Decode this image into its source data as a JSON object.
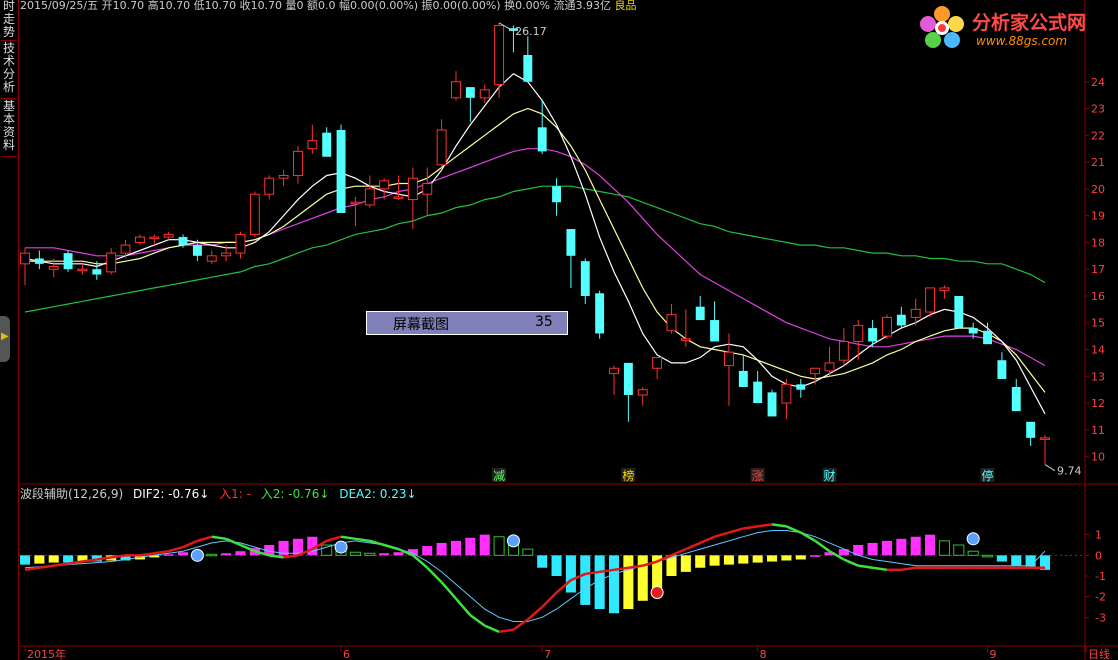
{
  "sidebar": {
    "tabs": [
      "时走势",
      "技术分析",
      "基本资料"
    ]
  },
  "infobar": {
    "text": "2015/09/25/五 开10.70 高10.70 低10.70 收10.70 量0 额0.0 幅0.00(0.00%) 振0.00(0.00%) 换0.00% 流通3.93亿",
    "tag": "良品"
  },
  "logo": {
    "title": "分析家公式网",
    "url": "www.88gs.com"
  },
  "screenshot_box": {
    "label": "屏幕截图",
    "value": "35"
  },
  "indicator": {
    "name": "波段辅助(12,26,9)",
    "dif2": "DIF2: -0.76",
    "in1": "入1: -",
    "in2": "入2: -0.76",
    "dea2": "DEA2: 0.23",
    "arrow": "↓"
  },
  "colors": {
    "up": "#ff3030",
    "down": "#54ffff",
    "ma_short": "#ffffff",
    "ma_mid": "#ffffa0",
    "ma_long": "#e040e0",
    "ma_longer": "#20c040",
    "grid": "#8b0000"
  },
  "chart_data": {
    "type": "candlestick",
    "price_axis": {
      "ylim": [
        9.5,
        25
      ],
      "ticks": [
        10,
        11,
        12,
        13,
        14,
        15,
        16,
        17,
        18,
        19,
        20,
        21,
        22,
        23,
        24
      ]
    },
    "annotations": {
      "high": "26.17",
      "low": "9.74"
    },
    "event_labels": [
      {
        "label": "减",
        "index": 18
      },
      {
        "label": "榜",
        "index": 23
      },
      {
        "label": "涨",
        "index": 28
      },
      {
        "label": "财",
        "index": 31
      },
      {
        "label": "停",
        "index": 37
      }
    ],
    "x_labels": [
      {
        "label": "2015年",
        "index": 0
      },
      {
        "label": "6",
        "index": 12
      },
      {
        "label": "7",
        "index": 20
      },
      {
        "label": "8",
        "index": 28
      },
      {
        "label": "9",
        "index": 37
      },
      {
        "label": "日线",
        "index": 39
      }
    ],
    "candles": [
      [
        17.2,
        17.8,
        16.4,
        17.6
      ],
      [
        17.4,
        17.7,
        17.0,
        17.2
      ],
      [
        17.0,
        17.4,
        16.7,
        17.1
      ],
      [
        17.6,
        17.7,
        16.9,
        17.0
      ],
      [
        17.0,
        17.2,
        16.8,
        17.0
      ],
      [
        17.0,
        17.3,
        16.6,
        16.8
      ],
      [
        16.9,
        17.8,
        16.8,
        17.6
      ],
      [
        17.6,
        18.1,
        17.4,
        17.9
      ],
      [
        18.0,
        18.3,
        17.9,
        18.2
      ],
      [
        18.2,
        18.3,
        17.9,
        18.2
      ],
      [
        18.2,
        18.4,
        18.1,
        18.3
      ],
      [
        18.2,
        18.3,
        17.8,
        17.9
      ],
      [
        17.9,
        18.1,
        17.3,
        17.5
      ],
      [
        17.3,
        17.7,
        17.2,
        17.5
      ],
      [
        17.5,
        17.9,
        17.3,
        17.6
      ],
      [
        17.6,
        18.4,
        17.4,
        18.3
      ],
      [
        18.3,
        19.9,
        18.2,
        19.8
      ],
      [
        19.8,
        20.5,
        19.6,
        20.4
      ],
      [
        20.4,
        20.7,
        20.1,
        20.5
      ],
      [
        20.5,
        21.6,
        20.2,
        21.4
      ],
      [
        21.5,
        22.4,
        21.3,
        21.8
      ],
      [
        22.1,
        22.3,
        21.3,
        21.2
      ],
      [
        22.2,
        22.4,
        19.5,
        19.1
      ],
      [
        19.5,
        19.7,
        18.6,
        19.5
      ],
      [
        19.4,
        20.5,
        19.3,
        20.0
      ],
      [
        20.0,
        20.4,
        19.6,
        20.3
      ],
      [
        19.7,
        20.5,
        19.6,
        19.7
      ],
      [
        19.6,
        20.8,
        18.5,
        20.4
      ],
      [
        19.8,
        20.8,
        19.0,
        20.2
      ],
      [
        20.9,
        22.6,
        20.8,
        22.2
      ],
      [
        23.4,
        24.4,
        23.3,
        24.0
      ],
      [
        23.8,
        23.8,
        22.5,
        23.4
      ],
      [
        23.4,
        23.9,
        23.2,
        23.7
      ],
      [
        23.9,
        26.2,
        23.4,
        26.1
      ],
      [
        26.0,
        26.1,
        25.1,
        25.9
      ],
      [
        25.0,
        25.7,
        24.0,
        24.0
      ],
      [
        22.3,
        23.3,
        21.3,
        21.4
      ],
      [
        20.1,
        20.4,
        19.0,
        19.5
      ],
      [
        18.5,
        18.5,
        16.3,
        17.5
      ],
      [
        17.3,
        17.4,
        15.7,
        16.0
      ],
      [
        16.1,
        16.2,
        14.4,
        14.6
      ],
      [
        13.1,
        13.4,
        12.3,
        13.3
      ],
      [
        13.5,
        13.5,
        11.3,
        12.3
      ],
      [
        12.3,
        12.6,
        11.9,
        12.5
      ],
      [
        13.3,
        13.6,
        12.9,
        13.7
      ],
      [
        14.7,
        15.7,
        14.6,
        15.3
      ],
      [
        14.4,
        15.5,
        14.1,
        14.4
      ],
      [
        15.6,
        16.0,
        15.1,
        15.1
      ],
      [
        15.1,
        15.8,
        14.6,
        14.3
      ],
      [
        13.4,
        14.6,
        11.9,
        13.9
      ],
      [
        13.2,
        13.8,
        12.8,
        12.6
      ],
      [
        12.8,
        13.2,
        12.1,
        12.0
      ],
      [
        12.4,
        12.5,
        11.9,
        11.5
      ],
      [
        12.0,
        12.9,
        11.4,
        12.7
      ],
      [
        12.7,
        12.9,
        12.2,
        12.5
      ],
      [
        13.1,
        13.3,
        12.7,
        13.3
      ],
      [
        13.2,
        14.1,
        13.0,
        13.5
      ],
      [
        13.6,
        14.8,
        13.4,
        14.3
      ],
      [
        14.3,
        15.1,
        13.6,
        14.9
      ],
      [
        14.8,
        15.1,
        14.1,
        14.3
      ],
      [
        14.5,
        15.3,
        14.4,
        15.2
      ],
      [
        15.3,
        15.6,
        14.8,
        14.9
      ],
      [
        15.2,
        15.9,
        14.9,
        15.5
      ],
      [
        15.4,
        16.3,
        15.2,
        16.3
      ],
      [
        16.2,
        16.4,
        15.9,
        16.3
      ],
      [
        16.0,
        16.0,
        14.8,
        14.8
      ],
      [
        14.8,
        15.0,
        14.4,
        14.6
      ],
      [
        14.7,
        15.0,
        14.2,
        14.2
      ],
      [
        13.6,
        13.9,
        12.9,
        12.9
      ],
      [
        12.6,
        12.9,
        11.8,
        11.7
      ],
      [
        11.3,
        11.3,
        10.4,
        10.7
      ],
      [
        10.7,
        10.8,
        9.7,
        10.7
      ]
    ],
    "ma": {
      "white": [
        17.3,
        17.3,
        17.2,
        17.2,
        17.2,
        17.1,
        17.3,
        17.5,
        17.7,
        17.9,
        18.1,
        18.1,
        18.0,
        17.9,
        17.8,
        17.8,
        18.0,
        18.4,
        19.0,
        19.6,
        20.1,
        20.5,
        20.6,
        20.4,
        20.1,
        19.9,
        19.8,
        19.7,
        20.0,
        20.7,
        21.6,
        22.4,
        23.1,
        23.8,
        24.3,
        24.0,
        23.3,
        22.4,
        21.2,
        19.8,
        18.2,
        16.9,
        15.8,
        14.6,
        13.8,
        13.5,
        13.5,
        13.7,
        14.1,
        14.2,
        14.1,
        13.6,
        13.0,
        12.7,
        12.6,
        12.8,
        13.1,
        13.4,
        13.8,
        14.2,
        14.5,
        14.8,
        15.0,
        15.3,
        15.5,
        15.4,
        15.2,
        14.8,
        14.3,
        13.6,
        12.6,
        11.6
      ],
      "yellow": [
        17.4,
        17.3,
        17.3,
        17.3,
        17.3,
        17.2,
        17.2,
        17.3,
        17.4,
        17.6,
        17.8,
        17.9,
        18.0,
        18.0,
        18.0,
        18.0,
        18.1,
        18.3,
        18.6,
        19.0,
        19.4,
        19.8,
        20.0,
        20.1,
        20.1,
        20.1,
        20.2,
        20.2,
        20.4,
        20.8,
        21.2,
        21.6,
        22.0,
        22.4,
        22.8,
        23.0,
        22.8,
        22.3,
        21.6,
        20.7,
        19.6,
        18.5,
        17.4,
        16.3,
        15.4,
        14.8,
        14.4,
        14.1,
        14.0,
        13.9,
        13.8,
        13.6,
        13.4,
        13.2,
        13.0,
        12.9,
        13.0,
        13.1,
        13.3,
        13.5,
        13.8,
        14.0,
        14.3,
        14.5,
        14.7,
        14.8,
        14.8,
        14.6,
        14.3,
        13.8,
        13.1,
        12.4
      ],
      "magenta": [
        17.8,
        17.8,
        17.8,
        17.7,
        17.6,
        17.5,
        17.5,
        17.5,
        17.6,
        17.7,
        17.8,
        17.9,
        17.9,
        17.9,
        18.0,
        18.0,
        18.1,
        18.3,
        18.5,
        18.7,
        18.9,
        19.1,
        19.3,
        19.4,
        19.6,
        19.7,
        19.9,
        20.0,
        20.2,
        20.4,
        20.6,
        20.8,
        21.0,
        21.2,
        21.4,
        21.5,
        21.5,
        21.4,
        21.2,
        20.9,
        20.5,
        20.0,
        19.5,
        18.9,
        18.3,
        17.8,
        17.3,
        16.8,
        16.5,
        16.2,
        15.9,
        15.6,
        15.3,
        15.0,
        14.8,
        14.6,
        14.4,
        14.3,
        14.2,
        14.1,
        14.1,
        14.2,
        14.3,
        14.4,
        14.5,
        14.5,
        14.5,
        14.4,
        14.2,
        14.0,
        13.7,
        13.4
      ],
      "green": [
        15.4,
        15.5,
        15.6,
        15.7,
        15.8,
        15.9,
        16.0,
        16.1,
        16.2,
        16.3,
        16.4,
        16.5,
        16.6,
        16.7,
        16.8,
        16.9,
        17.1,
        17.2,
        17.4,
        17.6,
        17.8,
        17.9,
        18.1,
        18.3,
        18.4,
        18.5,
        18.7,
        18.8,
        19.0,
        19.1,
        19.3,
        19.4,
        19.6,
        19.7,
        19.9,
        20.0,
        20.1,
        20.1,
        20.1,
        20.0,
        19.9,
        19.8,
        19.7,
        19.5,
        19.3,
        19.1,
        18.9,
        18.7,
        18.6,
        18.4,
        18.3,
        18.2,
        18.1,
        18.0,
        17.9,
        17.9,
        17.8,
        17.8,
        17.7,
        17.6,
        17.6,
        17.5,
        17.5,
        17.4,
        17.4,
        17.3,
        17.3,
        17.2,
        17.2,
        17.0,
        16.8,
        16.5
      ]
    },
    "macd_axis": {
      "ylim": [
        -4,
        2
      ],
      "ticks": [
        1,
        0,
        -1,
        -2,
        -3
      ]
    },
    "macd": {
      "hist": [
        -0.45,
        -0.4,
        -0.35,
        -0.35,
        -0.3,
        -0.3,
        -0.25,
        -0.25,
        -0.2,
        -0.1,
        0.05,
        0.15,
        0.1,
        0.05,
        0.1,
        0.2,
        0.35,
        0.5,
        0.7,
        0.8,
        0.9,
        0.5,
        0.2,
        0.15,
        0.1,
        0.1,
        0.15,
        0.3,
        0.45,
        0.6,
        0.7,
        0.85,
        1.0,
        0.9,
        0.6,
        0.3,
        -0.6,
        -1.0,
        -1.8,
        -2.4,
        -2.6,
        -2.8,
        -2.6,
        -2.2,
        -1.6,
        -1.0,
        -0.8,
        -0.6,
        -0.5,
        -0.45,
        -0.4,
        -0.35,
        -0.3,
        -0.25,
        -0.2,
        0.0,
        0.15,
        0.3,
        0.5,
        0.6,
        0.7,
        0.8,
        0.9,
        1.0,
        0.7,
        0.5,
        0.2,
        0.0,
        -0.3,
        -0.5,
        -0.6,
        -0.7
      ],
      "red": [
        -0.7,
        -0.6,
        -0.5,
        -0.4,
        -0.3,
        -0.2,
        -0.1,
        0.0,
        0.0,
        0.1,
        0.2,
        0.4,
        0.7,
        0.9,
        0.8,
        0.5,
        0.2,
        0.0,
        -0.1,
        0.0,
        0.3,
        0.7,
        0.9,
        0.8,
        0.7,
        0.5,
        0.3,
        0.0,
        -0.6,
        -1.3,
        -2.1,
        -2.9,
        -3.4,
        -3.7,
        -3.6,
        -3.1,
        -2.5,
        -1.8,
        -1.2,
        -0.9,
        -0.8,
        -0.7,
        -0.6,
        -0.5,
        -0.3,
        0.0,
        0.3,
        0.6,
        0.9,
        1.1,
        1.3,
        1.4,
        1.5,
        1.4,
        1.1,
        0.7,
        0.2,
        -0.2,
        -0.5,
        -0.6,
        -0.7,
        -0.7,
        -0.6,
        -0.6,
        -0.6,
        -0.6,
        -0.6,
        -0.6,
        -0.6,
        -0.6,
        -0.6,
        -0.6
      ],
      "blue": [
        -0.6,
        -0.55,
        -0.5,
        -0.45,
        -0.4,
        -0.35,
        -0.3,
        -0.2,
        -0.1,
        0.0,
        0.1,
        0.2,
        0.4,
        0.6,
        0.7,
        0.6,
        0.4,
        0.2,
        0.1,
        0.1,
        0.2,
        0.4,
        0.6,
        0.7,
        0.6,
        0.5,
        0.3,
        0.1,
        -0.3,
        -0.8,
        -1.4,
        -2.0,
        -2.6,
        -3.0,
        -3.2,
        -3.2,
        -3.0,
        -2.6,
        -2.1,
        -1.6,
        -1.2,
        -0.9,
        -0.7,
        -0.5,
        -0.3,
        -0.1,
        0.1,
        0.3,
        0.5,
        0.7,
        0.9,
        1.1,
        1.2,
        1.2,
        1.1,
        0.9,
        0.6,
        0.3,
        0.0,
        -0.2,
        -0.3,
        -0.4,
        -0.5,
        -0.5,
        -0.5,
        -0.5,
        -0.5,
        -0.5,
        -0.5,
        -0.5,
        -0.5,
        0.2
      ],
      "circles": [
        {
          "index": 12,
          "value": 0.0,
          "type": "blue"
        },
        {
          "index": 22,
          "value": 0.4,
          "type": "blue"
        },
        {
          "index": 34,
          "value": 0.7,
          "type": "blue"
        },
        {
          "index": 44,
          "value": -1.8,
          "type": "red"
        },
        {
          "index": 66,
          "value": 0.8,
          "type": "blue"
        }
      ]
    }
  }
}
